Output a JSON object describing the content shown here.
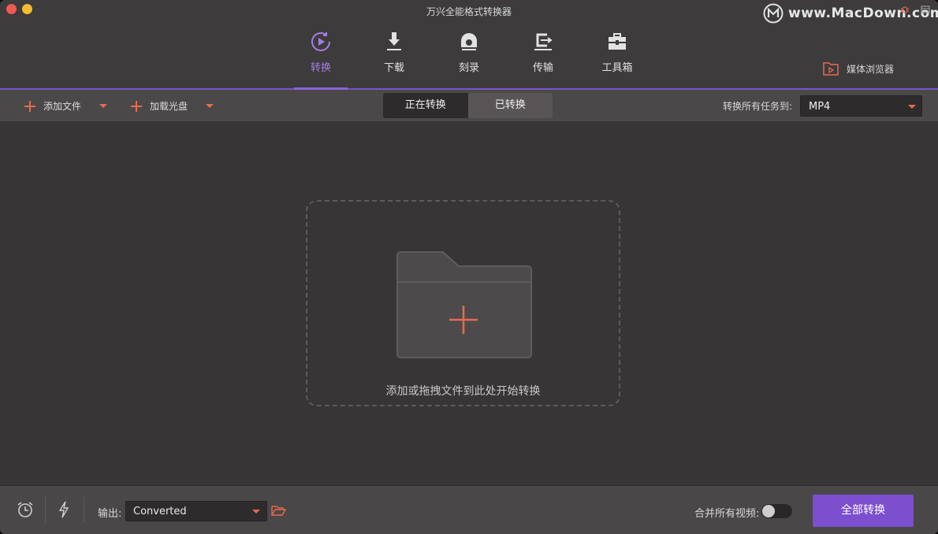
{
  "window": {
    "title": "万兴全能格式转换器",
    "watermark": "www.MacDown.com"
  },
  "tabs": [
    {
      "label": "转换",
      "icon": "convert-play-icon",
      "active": true
    },
    {
      "label": "下载",
      "icon": "download-icon",
      "active": false
    },
    {
      "label": "刻录",
      "icon": "burn-disc-icon",
      "active": false
    },
    {
      "label": "传输",
      "icon": "transfer-icon",
      "active": false
    },
    {
      "label": "工具箱",
      "icon": "toolbox-icon",
      "active": false
    }
  ],
  "media_browser": {
    "label": "媒体浏览器",
    "icon": "media-browser-icon"
  },
  "toolbar": {
    "add_file": "添加文件",
    "load_disc": "加载光盘",
    "segments": [
      "正在转换",
      "已转换"
    ],
    "active_segment": "正在转换",
    "convert_all_to_label": "转换所有任务到:",
    "format_value": "MP4"
  },
  "dropzone": {
    "hint": "添加或拖拽文件到此处开始转换"
  },
  "bottom": {
    "output_label": "输出:",
    "output_value": "Converted",
    "merge_label": "合并所有视频:",
    "merge_enabled": false,
    "convert_all_button": "全部转换"
  },
  "colors": {
    "accent": "#7c4fcf",
    "active_tab": "#a47ee6",
    "orange_icon": "#e86a4c",
    "window_bg": "#383536"
  }
}
